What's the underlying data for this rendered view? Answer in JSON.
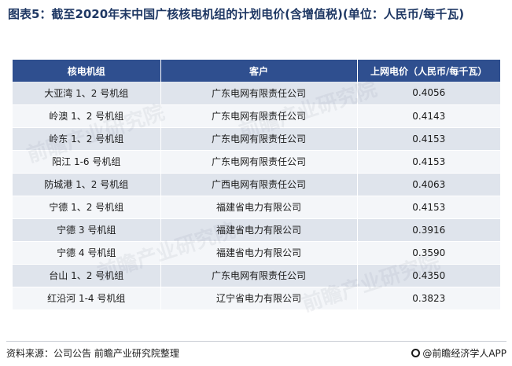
{
  "title": "图表5：截至2020年末中国广核核电机组的计划电价(含增值税)(单位：人民币/每千瓦)",
  "table": {
    "headers": [
      "核电机组",
      "客户",
      "上网电价（人民币/每千瓦）"
    ],
    "rows": [
      [
        "大亚湾 1、2 号机组",
        "广东电网有限责任公司",
        "0.4056"
      ],
      [
        "岭澳 1、2 号机组",
        "广东电网有限责任公司",
        "0.4143"
      ],
      [
        "岭东 1、2 号机组",
        "广东电网有限责任公司",
        "0.4153"
      ],
      [
        "阳江 1-6 号机组",
        "广东电网有限责任公司",
        "0.4153"
      ],
      [
        "防城港 1、2 号机组",
        "广西电网有限责任公司",
        "0.4063"
      ],
      [
        "宁德 1、2 号机组",
        "福建省电力有限公司",
        "0.4153"
      ],
      [
        "宁德 3 号机组",
        "福建省电力有限公司",
        "0.3916"
      ],
      [
        "宁德 4 号机组",
        "福建省电力有限公司",
        "0.3590"
      ],
      [
        "台山 1、2 号机组",
        "广东电网有限责任公司",
        "0.4350"
      ],
      [
        "红沿河 1-4 号机组",
        "辽宁省电力有限公司",
        "0.3823"
      ]
    ]
  },
  "watermark": "前瞻产业研究院",
  "footer": {
    "source": "资料来源：公司公告 前瞻产业研究院整理",
    "brand": "@前瞻经济学人APP",
    "brand_icon": "qianzhan-logo-icon"
  },
  "colors": {
    "header_bg": "#2f4f8f",
    "row_odd": "#dfe4ec",
    "row_even": "#f4f6f9",
    "title": "#1f3864"
  }
}
